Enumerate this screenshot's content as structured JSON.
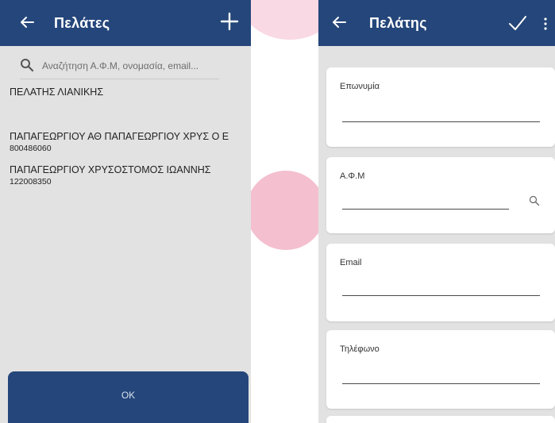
{
  "colors": {
    "appbar": "#24467a",
    "background": "#e2e2e2",
    "card": "#ffffff"
  },
  "left_screen": {
    "title": "Πελάτες",
    "back_icon": "arrow-left-icon",
    "add_icon": "plus-icon",
    "search": {
      "icon": "search-icon",
      "placeholder": "Αναζήτηση Α.Φ.Μ, ονομασία, email..."
    },
    "customers": [
      {
        "name": "ΠΕΛΑΤΗΣ ΛΙΑΝΙΚΗΣ",
        "afm": ""
      },
      {
        "name": "ΠΑΠΑΓΕΩΡΓΙΟΥ ΑΘ ΠΑΠΑΓΕΩΡΓΙΟΥ ΧΡΥΣ Ο Ε",
        "afm": "800486060"
      },
      {
        "name": "ΠΑΠΑΓΕΩΡΓΙΟΥ  ΧΡΥΣΟΣΤΟΜΟΣ ΙΩΑΝΝΗΣ",
        "afm": "122008350"
      }
    ],
    "ok_label": "OK"
  },
  "right_screen": {
    "title": "Πελάτης",
    "back_icon": "arrow-left-icon",
    "confirm_icon": "check-icon",
    "more_icon": "more-vert-icon",
    "fields": [
      {
        "label": "Επωνυμία",
        "value": ""
      },
      {
        "label": "Α.Φ.Μ",
        "value": ""
      },
      {
        "label": "Email",
        "value": ""
      },
      {
        "label": "Τηλέφωνο",
        "value": ""
      }
    ]
  }
}
